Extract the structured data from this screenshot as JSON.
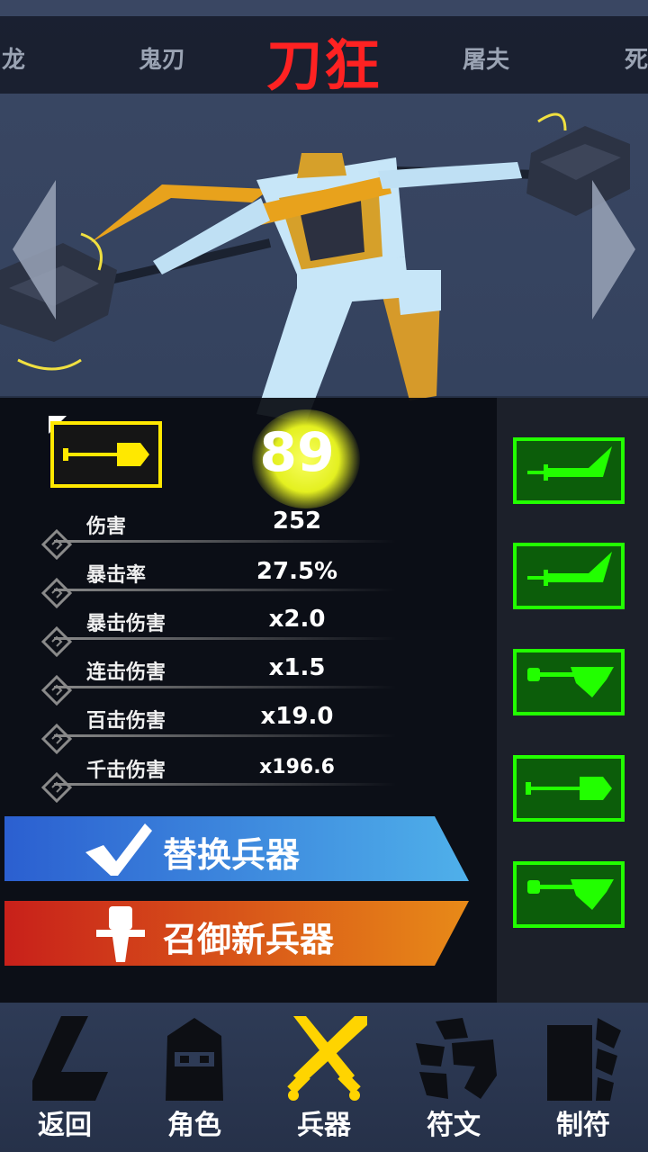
{
  "character_selector": {
    "items": [
      "龙",
      "鬼刃",
      "刀狂",
      "屠夫",
      "死"
    ],
    "current": "刀狂"
  },
  "weapon": {
    "level": "89",
    "stats": [
      {
        "label": "伤害",
        "value": "252"
      },
      {
        "label": "暴击率",
        "value": "27.5%"
      },
      {
        "label": "暴击伤害",
        "value": "x2.0"
      },
      {
        "label": "连击伤害",
        "value": "x1.5"
      },
      {
        "label": "百击伤害",
        "value": "x19.0"
      },
      {
        "label": "千击伤害",
        "value": "x196.6"
      }
    ]
  },
  "actions": {
    "replace_label": "替换兵器",
    "summon_label": "召御新兵器"
  },
  "inventory_slots": [
    "blade-icon",
    "blade-icon",
    "hammer-icon",
    "mace-icon",
    "hammer-icon"
  ],
  "bottom_nav": [
    {
      "label": "返回",
      "icon": "back-icon"
    },
    {
      "label": "角色",
      "icon": "ninja-icon"
    },
    {
      "label": "兵器",
      "icon": "crossed-swords-icon"
    },
    {
      "label": "符文",
      "icon": "rune-icon"
    },
    {
      "label": "制符",
      "icon": "craft-icon"
    }
  ],
  "colors": {
    "title_red": "#ff2222",
    "selected_yellow": "#ffe800",
    "slot_green": "#22ff00",
    "replace_blue": "#2f6fd6",
    "summon_red": "#d62a1a",
    "nav_active": "#ffd400"
  }
}
